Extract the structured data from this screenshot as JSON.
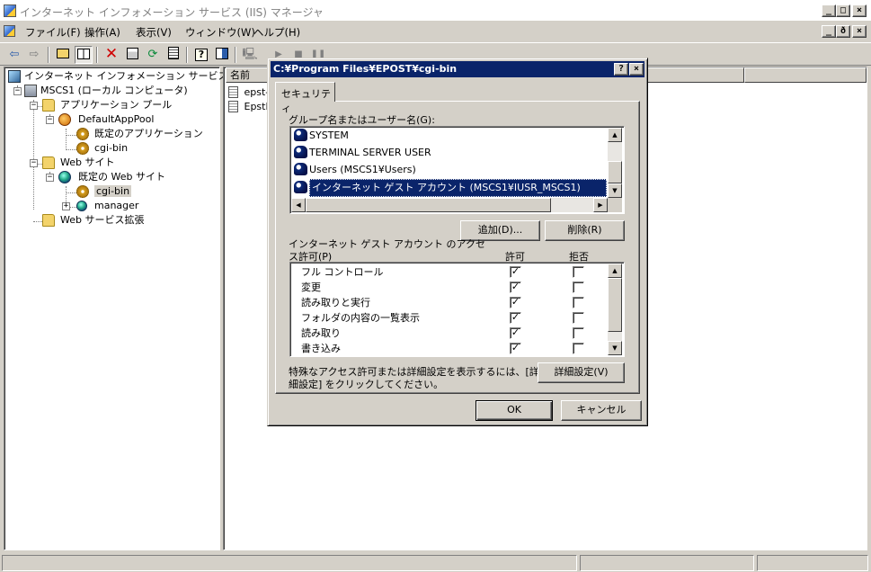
{
  "window": {
    "title": "インターネット インフォメーション サービス (IIS) マネージャ",
    "caption_buttons": [
      "_",
      "□",
      "×"
    ],
    "inner_caption_buttons": [
      "_",
      "ð",
      "×"
    ]
  },
  "menubar": {
    "items": [
      "ファイル(F)",
      "操作(A)",
      "表示(V)",
      "ウィンドウ(W)",
      "ヘルプ(H)"
    ]
  },
  "toolbar": {
    "icons": [
      "back-arrow-icon",
      "forward-arrow-icon",
      "up-folder-icon",
      "show-tree-icon",
      "delete-icon",
      "properties-icon",
      "refresh-icon",
      "export-list-icon",
      "help-icon",
      "console-icon",
      "computer-icon",
      "play-icon",
      "stop-icon",
      "pause-icon"
    ]
  },
  "tree": {
    "root": "インターネット インフォメーション サービス",
    "server": "MSCS1 (ローカル コンピュータ)",
    "app_pools": "アプリケーション プール",
    "default_pool": "DefaultAppPool",
    "default_app": "既定のアプリケーション",
    "cgi_pool_item": "cgi-bin",
    "web_sites": "Web サイト",
    "default_site": "既定の Web サイト",
    "cgi_bin": "cgi-bin",
    "manager": "manager",
    "web_ext": "Web サービス拡張"
  },
  "list": {
    "column_name": "名前",
    "rows": [
      "epst-",
      "Epstl"
    ]
  },
  "dialog": {
    "title": "C:¥Program Files¥EPOST¥cgi-bin",
    "help_btn": "?",
    "close_btn": "×",
    "tab_security": "セキュリティ",
    "group_label": "グループ名またはユーザー名(G):",
    "users": [
      "SYSTEM",
      "TERMINAL SERVER USER",
      "Users (MSCS1¥Users)",
      "インターネット ゲスト アカウント (MSCS1¥IUSR_MSCS1)"
    ],
    "add_btn": "追加(D)...",
    "remove_btn": "削除(R)",
    "perm_label_line1": "インターネット ゲスト アカウント のアクセ",
    "perm_label_line2": "ス許可(P)",
    "allow_header": "許可",
    "deny_header": "拒否",
    "permissions": [
      {
        "name": "フル コントロール",
        "allow": true,
        "deny": false
      },
      {
        "name": "変更",
        "allow": true,
        "deny": false
      },
      {
        "name": "読み取りと実行",
        "allow": true,
        "deny": false
      },
      {
        "name": "フォルダの内容の一覧表示",
        "allow": true,
        "deny": false
      },
      {
        "name": "読み取り",
        "allow": true,
        "deny": false
      },
      {
        "name": "書き込み",
        "allow": true,
        "deny": false
      }
    ],
    "advanced_text_line1": "特殊なアクセス許可または詳細設定を表示するには、[詳",
    "advanced_text_line2": "細設定] をクリックしてください。",
    "advanced_btn": "詳細設定(V)",
    "ok_btn": "OK",
    "cancel_btn": "キャンセル",
    "check_glyph": "✓"
  },
  "colors": {
    "face": "#d4d0c8",
    "title_active": "#0a246a",
    "selection": "#0a246a",
    "selection_text": "#ffffff"
  }
}
